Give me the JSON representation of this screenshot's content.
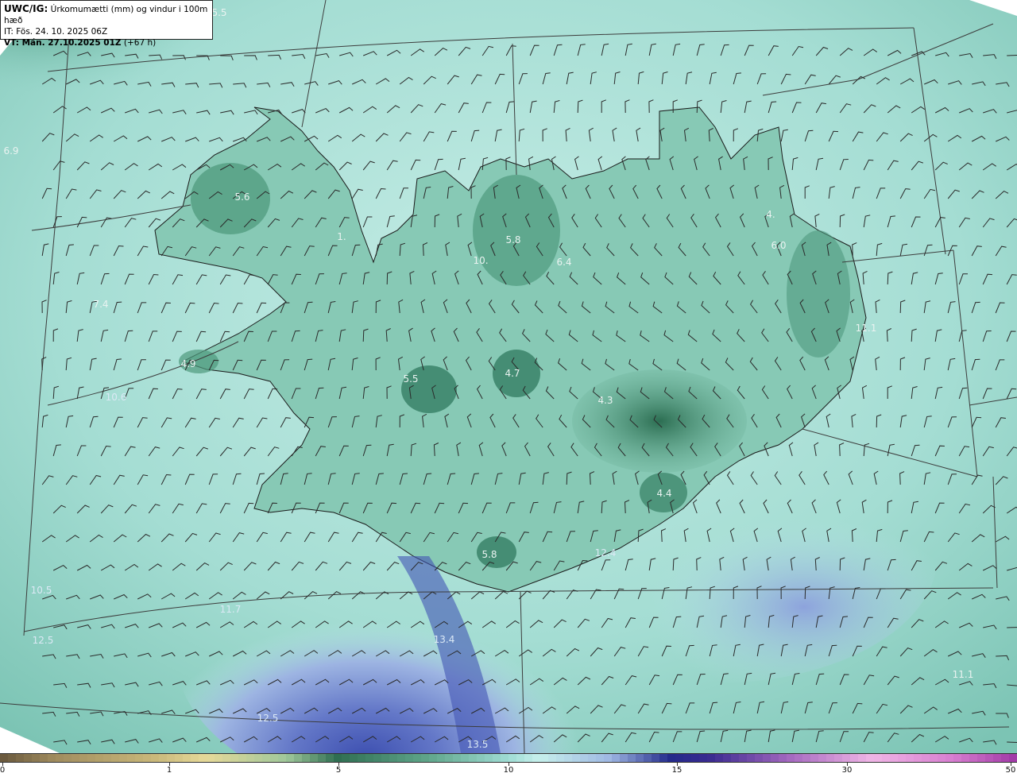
{
  "header": {
    "model": "UWC/IG:",
    "title": "Úrkomumætti (mm) og vindur i 100m hæð",
    "init_time": "IT: Fös. 24. 10. 2025 06Z",
    "valid_prefix": "VT: Mán. 27.10.2025 01Z",
    "lead_time": "(+67 h)"
  },
  "colors": {
    "ocean_base": "#9fdcd4",
    "land_base": "#7fc2ad",
    "high_terrain": "#2f7a5c",
    "precip_blue": "#8a9ed8",
    "precip_deep": "#4a5ab6",
    "coast": "#1a1a1a",
    "grid": "#3c3c3c"
  },
  "colorbar": {
    "ticks": [
      "0",
      "1",
      "5",
      "10",
      "15",
      "30",
      "50"
    ],
    "tick_values": [
      0,
      1,
      5,
      10,
      15,
      30,
      50
    ]
  },
  "value_labels": [
    "5.5",
    "6.9",
    "5.6",
    "5.8",
    "10.",
    "6.4",
    "6.0",
    "7.4",
    "4.9",
    "5.5",
    "4.7",
    "4.3",
    "11.1",
    "4.4",
    "5.8",
    "12.4",
    "10.5",
    "11.7",
    "13.4",
    "12.5",
    "13.5",
    "11.1",
    "4.",
    "1.",
    "10.6",
    "12.5"
  ]
}
